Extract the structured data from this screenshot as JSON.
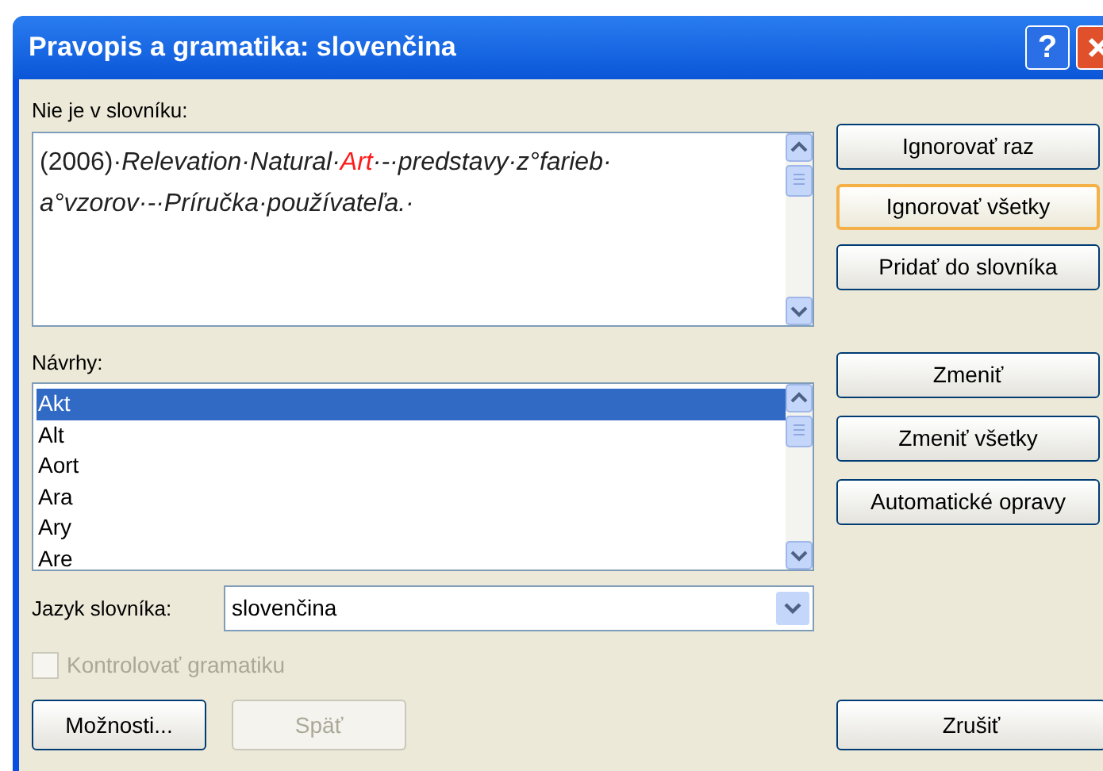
{
  "window": {
    "title": "Pravopis a gramatika: slovenčina",
    "help_button": "?"
  },
  "not_in_dictionary": {
    "label": "Nie je v slovníku:",
    "lines": [
      [
        {
          "text": "(2006)·",
          "kind": "normal"
        },
        {
          "text": "Relevation·Natural·",
          "kind": "italic"
        },
        {
          "text": "Art",
          "kind": "error"
        },
        {
          "text": "·-·predstavy·z°farieb·",
          "kind": "italic"
        }
      ],
      [
        {
          "text": "a°vzorov·-·Príručka·používateľa.·",
          "kind": "italic"
        }
      ]
    ]
  },
  "top_buttons": [
    {
      "label": "Ignorovať raz",
      "focused": false
    },
    {
      "label": "Ignorovať všetky",
      "focused": true
    },
    {
      "label": "Pridať do slovníka",
      "focused": false
    }
  ],
  "suggestions": {
    "label": "Návrhy:",
    "items": [
      {
        "text": "Akt",
        "selected": true
      },
      {
        "text": "Alt",
        "selected": false
      },
      {
        "text": "Aort",
        "selected": false
      },
      {
        "text": "Ara",
        "selected": false
      },
      {
        "text": "Ary",
        "selected": false
      },
      {
        "text": "Are",
        "selected": false
      }
    ]
  },
  "change_buttons": [
    {
      "label": "Zmeniť"
    },
    {
      "label": "Zmeniť všetky"
    },
    {
      "label": "Automatické opravy"
    }
  ],
  "dictionary_language": {
    "label": "Jazyk slovníka:",
    "value": "slovenčina"
  },
  "check_grammar": {
    "label": "Kontrolovať gramatiku",
    "checked": false,
    "disabled": true
  },
  "bottom_buttons": [
    {
      "label": "Možnosti...",
      "disabled": false
    },
    {
      "label": "Späť",
      "disabled": true
    }
  ],
  "cancel_button": {
    "label": "Zrušiť"
  }
}
